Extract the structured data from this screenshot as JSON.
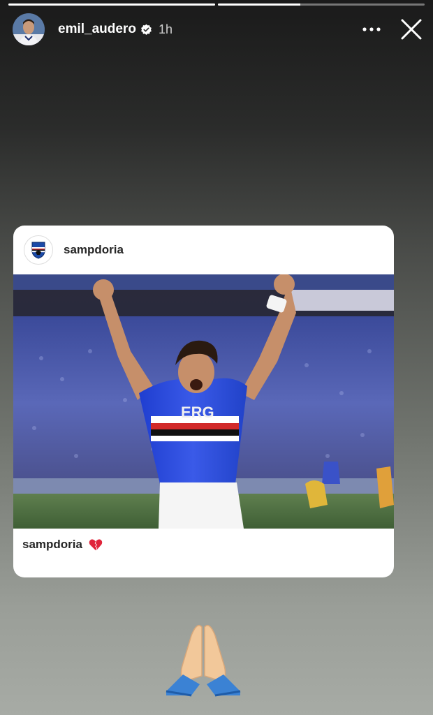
{
  "story": {
    "progress": [
      {
        "fraction": 1.0
      },
      {
        "fraction": 0.4
      }
    ],
    "username": "emil_audero",
    "verified": true,
    "time": "1h",
    "more_icon": "more-horizontal-icon",
    "close_icon": "close-icon"
  },
  "shared_post": {
    "username": "sampdoria",
    "caption_user": "sampdoria",
    "caption_emoji": "broken-heart-icon",
    "photo": "sampdoria-player-celebrating"
  },
  "sticker": {
    "emoji": "folded-hands-icon"
  }
}
